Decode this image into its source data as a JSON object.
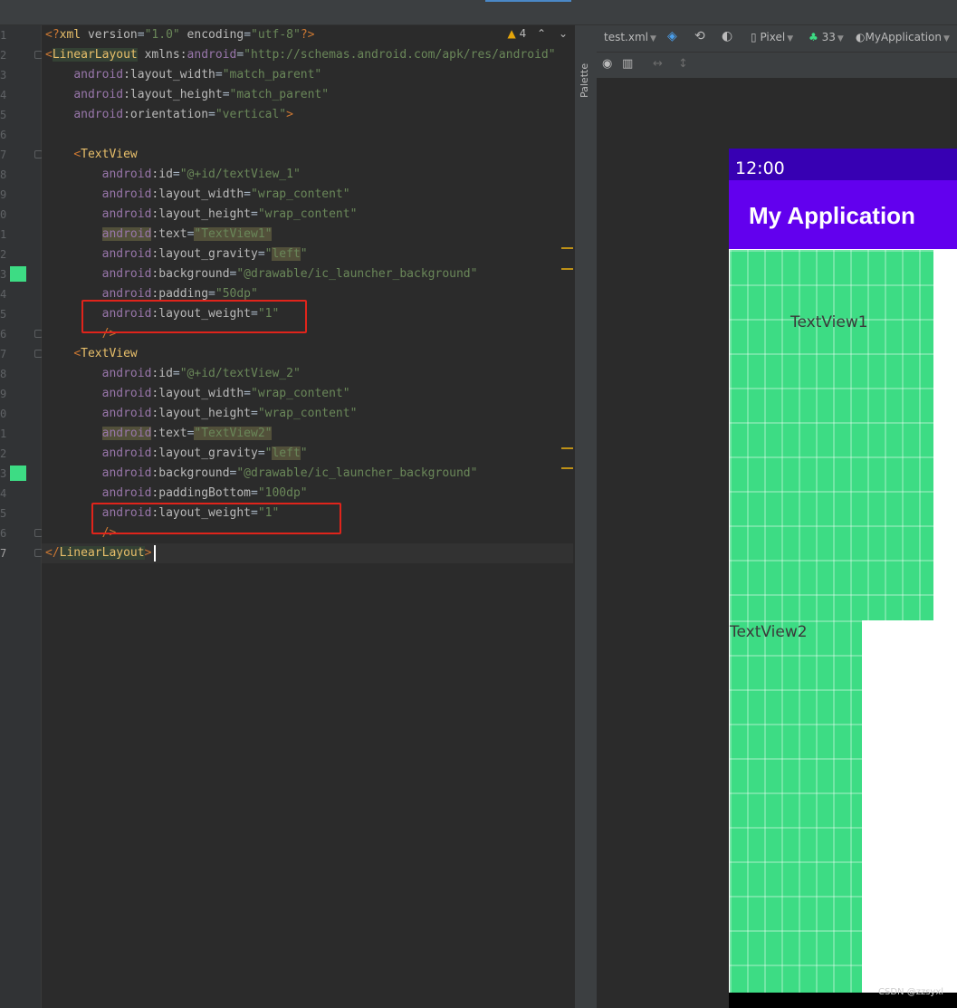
{
  "editor": {
    "line_numbers": [
      "1",
      "2",
      "3",
      "4",
      "5",
      "6",
      "7",
      "8",
      "9",
      "0",
      "1",
      "2",
      "3",
      "4",
      "5",
      "6",
      "7",
      "8",
      "9",
      "0",
      "1",
      "2",
      "3",
      "4",
      "5",
      "6",
      "7"
    ],
    "warning_count": "4",
    "lines": [
      [
        [
          "brk",
          "<?"
        ],
        [
          "tag",
          "xml"
        ],
        [
          "attr",
          " version"
        ],
        [
          "pun",
          "="
        ],
        [
          "str",
          "\"1.0\""
        ],
        [
          "attr",
          " encoding"
        ],
        [
          "pun",
          "="
        ],
        [
          "str",
          "\"utf-8\""
        ],
        [
          "brk",
          "?>"
        ]
      ],
      [
        [
          "brk",
          "<"
        ],
        [
          "tag",
          "LinearLayout",
          "hl-tag"
        ],
        [
          "attr",
          " xmlns:"
        ],
        [
          "ns",
          "android"
        ],
        [
          "pun",
          "="
        ],
        [
          "str",
          "\"http://schemas.android.com/apk/res/android\""
        ]
      ],
      [
        [
          "attr",
          "    "
        ],
        [
          "ns",
          "android"
        ],
        [
          "attr",
          ":layout_width"
        ],
        [
          "pun",
          "="
        ],
        [
          "str",
          "\"match_parent\""
        ]
      ],
      [
        [
          "attr",
          "    "
        ],
        [
          "ns",
          "android"
        ],
        [
          "attr",
          ":layout_height"
        ],
        [
          "pun",
          "="
        ],
        [
          "str",
          "\"match_parent\""
        ]
      ],
      [
        [
          "attr",
          "    "
        ],
        [
          "ns",
          "android"
        ],
        [
          "attr",
          ":orientation"
        ],
        [
          "pun",
          "="
        ],
        [
          "str",
          "\"vertical\""
        ],
        [
          "brk",
          ">"
        ]
      ],
      [],
      [
        [
          "attr",
          "    "
        ],
        [
          "brk",
          "<"
        ],
        [
          "tag",
          "TextView"
        ]
      ],
      [
        [
          "attr",
          "        "
        ],
        [
          "ns",
          "android"
        ],
        [
          "attr",
          ":id"
        ],
        [
          "pun",
          "="
        ],
        [
          "str",
          "\"@+id/textView_1\""
        ]
      ],
      [
        [
          "attr",
          "        "
        ],
        [
          "ns",
          "android"
        ],
        [
          "attr",
          ":layout_width"
        ],
        [
          "pun",
          "="
        ],
        [
          "str",
          "\"wrap_content\""
        ]
      ],
      [
        [
          "attr",
          "        "
        ],
        [
          "ns",
          "android"
        ],
        [
          "attr",
          ":layout_height"
        ],
        [
          "pun",
          "="
        ],
        [
          "str",
          "\"wrap_content\""
        ]
      ],
      [
        [
          "attr",
          "        "
        ],
        [
          "ns",
          "android",
          "hl-warn"
        ],
        [
          "attr",
          ":text"
        ],
        [
          "pun",
          "="
        ],
        [
          "str",
          "\"TextView1\"",
          "hl-warn"
        ]
      ],
      [
        [
          "attr",
          "        "
        ],
        [
          "ns",
          "android"
        ],
        [
          "attr",
          ":layout_gravity"
        ],
        [
          "pun",
          "="
        ],
        [
          "str",
          "\"",
          ""
        ],
        [
          "str",
          "left",
          "hl-warn"
        ],
        [
          "str",
          "\""
        ]
      ],
      [
        [
          "attr",
          "        "
        ],
        [
          "ns",
          "android"
        ],
        [
          "attr",
          ":background"
        ],
        [
          "pun",
          "="
        ],
        [
          "str",
          "\"@drawable/ic_launcher_background\""
        ]
      ],
      [
        [
          "attr",
          "        "
        ],
        [
          "ns",
          "android"
        ],
        [
          "attr",
          ":padding"
        ],
        [
          "pun",
          "="
        ],
        [
          "str",
          "\"50dp\""
        ]
      ],
      [
        [
          "attr",
          "        "
        ],
        [
          "ns",
          "android"
        ],
        [
          "attr",
          ":layout_weight"
        ],
        [
          "pun",
          "="
        ],
        [
          "str",
          "\"1\""
        ]
      ],
      [
        [
          "attr",
          "        "
        ],
        [
          "brk",
          "/>"
        ]
      ],
      [
        [
          "attr",
          "    "
        ],
        [
          "brk",
          "<"
        ],
        [
          "tag",
          "TextView"
        ]
      ],
      [
        [
          "attr",
          "        "
        ],
        [
          "ns",
          "android"
        ],
        [
          "attr",
          ":id"
        ],
        [
          "pun",
          "="
        ],
        [
          "str",
          "\"@+id/textView_2\""
        ]
      ],
      [
        [
          "attr",
          "        "
        ],
        [
          "ns",
          "android"
        ],
        [
          "attr",
          ":layout_width"
        ],
        [
          "pun",
          "="
        ],
        [
          "str",
          "\"wrap_content\""
        ]
      ],
      [
        [
          "attr",
          "        "
        ],
        [
          "ns",
          "android"
        ],
        [
          "attr",
          ":layout_height"
        ],
        [
          "pun",
          "="
        ],
        [
          "str",
          "\"wrap_content\""
        ]
      ],
      [
        [
          "attr",
          "        "
        ],
        [
          "ns",
          "android",
          "hl-warn"
        ],
        [
          "attr",
          ":text"
        ],
        [
          "pun",
          "="
        ],
        [
          "str",
          "\"TextView2\"",
          "hl-warn"
        ]
      ],
      [
        [
          "attr",
          "        "
        ],
        [
          "ns",
          "android"
        ],
        [
          "attr",
          ":layout_gravity"
        ],
        [
          "pun",
          "="
        ],
        [
          "str",
          "\"",
          ""
        ],
        [
          "str",
          "left",
          "hl-warn"
        ],
        [
          "str",
          "\""
        ]
      ],
      [
        [
          "attr",
          "        "
        ],
        [
          "ns",
          "android"
        ],
        [
          "attr",
          ":background"
        ],
        [
          "pun",
          "="
        ],
        [
          "str",
          "\"@drawable/ic_launcher_background\""
        ]
      ],
      [
        [
          "attr",
          "        "
        ],
        [
          "ns",
          "android"
        ],
        [
          "attr",
          ":paddingBottom"
        ],
        [
          "pun",
          "="
        ],
        [
          "str",
          "\"100dp\""
        ]
      ],
      [
        [
          "attr",
          "        "
        ],
        [
          "ns",
          "android"
        ],
        [
          "attr",
          ":layout_weight"
        ],
        [
          "pun",
          "="
        ],
        [
          "str",
          "\"1\""
        ]
      ],
      [
        [
          "attr",
          "        "
        ],
        [
          "brk",
          "/>"
        ]
      ],
      [
        [
          "brk",
          "</"
        ],
        [
          "tag",
          "LinearLayout",
          "hl-tag"
        ],
        [
          "brk",
          ">"
        ]
      ]
    ]
  },
  "palette_label": "Palette",
  "design_toolbar": {
    "file": "test.xml",
    "device": "Pixel",
    "api": "33",
    "theme": "MyApplication"
  },
  "preview": {
    "status_time": "12:00",
    "app_title": "My Application",
    "textview1": "TextView1",
    "textview2": "TextView2",
    "status_color": "#3700b3",
    "appbar_color": "#6200ee",
    "view_bg_color": "#3ddc84"
  },
  "watermark": "CSDN @zzsyxl"
}
